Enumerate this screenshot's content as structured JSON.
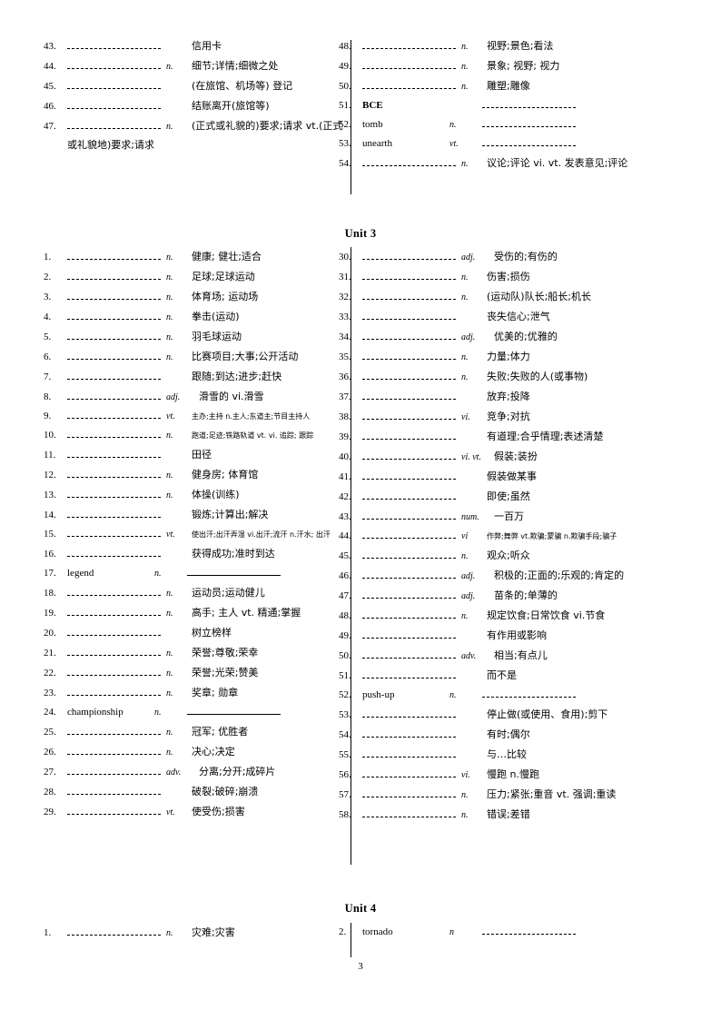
{
  "page": {
    "number": "3"
  },
  "units": [
    {
      "heading": "",
      "left_items": [
        {
          "num": "43.",
          "word": "",
          "pos": "",
          "meaning": "信用卡",
          "blank": "dash"
        },
        {
          "num": "44.",
          "word": "",
          "pos": "n.",
          "meaning": "细节;详情;细微之处",
          "blank": "dash"
        },
        {
          "num": "45.",
          "word": "",
          "pos": "",
          "meaning": "(在旅馆、机场等) 登记",
          "blank": "dash"
        },
        {
          "num": "46.",
          "word": "",
          "pos": "",
          "meaning": "结账离开(旅馆等)",
          "blank": "dash"
        },
        {
          "num": "47.",
          "word": "",
          "pos": "n.",
          "meaning": "(正式或礼貌的)要求;请求   vt.(正式",
          "blank": "dash",
          "continuation": "或礼貌地)要求;请求"
        }
      ],
      "right_items": [
        {
          "num": "48.",
          "word": "",
          "pos": "n.",
          "meaning": "视野;景色;看法",
          "blank": "dash"
        },
        {
          "num": "49.",
          "word": "",
          "pos": "n.",
          "meaning": "景象; 视野; 视力",
          "blank": "dash"
        },
        {
          "num": "50.",
          "word": "",
          "pos": "n.",
          "meaning": "雕塑;雕像",
          "blank": "dash"
        },
        {
          "num": "51.",
          "word": "BCE",
          "pos": "",
          "meaning": "",
          "blank": "answer-dash",
          "bold": true
        },
        {
          "num": "52.",
          "word": "tomb",
          "pos": "n.",
          "meaning": "",
          "blank": "answer-dash"
        },
        {
          "num": "53.",
          "word": "unearth",
          "pos": "vt.",
          "meaning": "",
          "blank": "answer-dash"
        },
        {
          "num": "54.",
          "word": "",
          "pos": "n.",
          "meaning": "议论;评论 vi. vt. 发表意见;评论",
          "blank": "dash"
        }
      ]
    },
    {
      "heading": "Unit 3",
      "left_items": [
        {
          "num": "1.",
          "word": "",
          "pos": "n.",
          "meaning": "健康; 健壮;适合",
          "blank": "dash"
        },
        {
          "num": "2.",
          "word": "",
          "pos": "n.",
          "meaning": "足球;足球运动",
          "blank": "dash"
        },
        {
          "num": "3.",
          "word": "",
          "pos": "n.",
          "meaning": "体育场; 运动场",
          "blank": "dash"
        },
        {
          "num": "4.",
          "word": "",
          "pos": "n.",
          "meaning": "拳击(运动)",
          "blank": "dash"
        },
        {
          "num": "5.",
          "word": "",
          "pos": "n.",
          "meaning": "羽毛球运动",
          "blank": "dash"
        },
        {
          "num": "6.",
          "word": "",
          "pos": "n.",
          "meaning": "比赛项目;大事;公开活动",
          "blank": "dash"
        },
        {
          "num": "7.",
          "word": "",
          "pos": "",
          "meaning": "跟随;到达;进步;赶快",
          "blank": "dash"
        },
        {
          "num": "8.",
          "word": "",
          "pos": "adj.",
          "meaning": "滑雪的 vi.滑雪",
          "blank": "dash"
        },
        {
          "num": "9.",
          "word": "",
          "pos": "vt.",
          "meaning": "主办;主持 n.主人;东道主;节目主持人",
          "blank": "dash",
          "small": true
        },
        {
          "num": "10.",
          "word": "",
          "pos": "n.",
          "meaning": "跑道;足迹;铁路轨道  vt. vi. 追踪; 跟踪",
          "blank": "dash",
          "small": true
        },
        {
          "num": "11.",
          "word": "",
          "pos": "",
          "meaning": "田径",
          "blank": "dash"
        },
        {
          "num": "12.",
          "word": "",
          "pos": "n.",
          "meaning": "健身房; 体育馆",
          "blank": "dash"
        },
        {
          "num": "13.",
          "word": "",
          "pos": "n.",
          "meaning": "体操(训练)",
          "blank": "dash"
        },
        {
          "num": "14.",
          "word": "",
          "pos": "",
          "meaning": "锻炼;计算出;解决",
          "blank": "dash"
        },
        {
          "num": "15.",
          "word": "",
          "pos": "vt.",
          "meaning": "使出汗;出汗弄湿  vi.出汗;流汗  n.汗水; 出汗",
          "blank": "dash",
          "small": true
        },
        {
          "num": "16.",
          "word": "",
          "pos": "",
          "meaning": "获得成功;准时到达",
          "blank": "dash"
        },
        {
          "num": "17.",
          "word": "legend",
          "pos": "n.",
          "meaning": "",
          "blank": "answer-solid"
        },
        {
          "num": "18.",
          "word": "",
          "pos": "n.",
          "meaning": "运动员;运动健儿",
          "blank": "dash"
        },
        {
          "num": "19.",
          "word": "",
          "pos": "n.",
          "meaning": "高手; 主人 vt. 精通;掌握",
          "blank": "dash"
        },
        {
          "num": "20.",
          "word": "",
          "pos": "",
          "meaning": "树立榜样",
          "blank": "dash"
        },
        {
          "num": "21.",
          "word": "",
          "pos": "n.",
          "meaning": "荣誉;尊敬;荣幸",
          "blank": "dash"
        },
        {
          "num": "22.",
          "word": "",
          "pos": "n.",
          "meaning": "荣誉;光荣;赞美",
          "blank": "dash"
        },
        {
          "num": "23.",
          "word": "",
          "pos": "n.",
          "meaning": "奖章; 勋章",
          "blank": "dash"
        },
        {
          "num": "24.",
          "word": "championship",
          "pos": "n.",
          "meaning": "",
          "blank": "answer-solid"
        },
        {
          "num": "25.",
          "word": "",
          "pos": "n.",
          "meaning": "冠军; 优胜者",
          "blank": "dash"
        },
        {
          "num": "26.",
          "word": "",
          "pos": "n.",
          "meaning": "决心;决定",
          "blank": "dash"
        },
        {
          "num": "27.",
          "word": "",
          "pos": "adv.",
          "meaning": "分离;分开;成碎片",
          "blank": "dash"
        },
        {
          "num": "28.",
          "word": "",
          "pos": "",
          "meaning": "破裂;破碎;崩溃",
          "blank": "dash"
        },
        {
          "num": "29.",
          "word": "",
          "pos": "vt.",
          "meaning": "使受伤;损害",
          "blank": "dash"
        }
      ],
      "right_items": [
        {
          "num": "30.",
          "word": "",
          "pos": "adj.",
          "meaning": "受伤的;有伤的",
          "blank": "dash"
        },
        {
          "num": "31.",
          "word": "",
          "pos": "n.",
          "meaning": "伤害;损伤",
          "blank": "dash"
        },
        {
          "num": "32.",
          "word": "",
          "pos": "n.",
          "meaning": "(运动队)队长;船长;机长",
          "blank": "dash"
        },
        {
          "num": "33.",
          "word": "",
          "pos": "",
          "meaning": "丧失信心;泄气",
          "blank": "dash"
        },
        {
          "num": "34.",
          "word": "",
          "pos": "adj.",
          "meaning": "优美的;优雅的",
          "blank": "dash"
        },
        {
          "num": "35.",
          "word": "",
          "pos": "n.",
          "meaning": "力量;体力",
          "blank": "dash"
        },
        {
          "num": "36.",
          "word": "",
          "pos": "n.",
          "meaning": "失败;失败的人(或事物)",
          "blank": "dash"
        },
        {
          "num": "37.",
          "word": "",
          "pos": "",
          "meaning": "放弃;投降",
          "blank": "dash"
        },
        {
          "num": "38.",
          "word": "",
          "pos": "vi.",
          "meaning": "竞争;对抗",
          "blank": "dash"
        },
        {
          "num": "39.",
          "word": "",
          "pos": "",
          "meaning": "有道理;合乎情理;表述清楚",
          "blank": "dash"
        },
        {
          "num": "40.",
          "word": "",
          "pos": "vi. vt.",
          "meaning": "假装;装扮",
          "blank": "dash"
        },
        {
          "num": "41.",
          "word": "",
          "pos": "",
          "meaning": "假装做某事",
          "blank": "dash"
        },
        {
          "num": "42.",
          "word": "",
          "pos": "",
          "meaning": "即使;虽然",
          "blank": "dash"
        },
        {
          "num": "43.",
          "word": "",
          "pos": "num.",
          "meaning": "一百万",
          "blank": "dash"
        },
        {
          "num": "44.",
          "word": "",
          "pos": "vi",
          "meaning": "作弊;舞弊 vt.欺骗;蒙骗  n.欺骗手段;骗子",
          "blank": "dash",
          "small": true
        },
        {
          "num": "45.",
          "word": "",
          "pos": "n.",
          "meaning": "观众;听众",
          "blank": "dash"
        },
        {
          "num": "46.",
          "word": "",
          "pos": "adj.",
          "meaning": "积极的;正面的;乐观的;肯定的",
          "blank": "dash"
        },
        {
          "num": "47.",
          "word": "",
          "pos": "adj.",
          "meaning": "苗条的;单薄的",
          "blank": "dash"
        },
        {
          "num": "48.",
          "word": "",
          "pos": "n.",
          "meaning": "规定饮食;日常饮食 vi.节食",
          "blank": "dash"
        },
        {
          "num": "49.",
          "word": "",
          "pos": "",
          "meaning": "有作用或影响",
          "blank": "dash"
        },
        {
          "num": "50.",
          "word": "",
          "pos": "adv.",
          "meaning": "相当;有点儿",
          "blank": "dash"
        },
        {
          "num": "51.",
          "word": "",
          "pos": "",
          "meaning": "而不是",
          "blank": "dash"
        },
        {
          "num": "52.",
          "word": "push-up",
          "pos": "n.",
          "meaning": "",
          "blank": "answer-dash"
        },
        {
          "num": "53.",
          "word": "",
          "pos": "",
          "meaning": "停止做(或使用、食用);剪下",
          "blank": "dash"
        },
        {
          "num": "54.",
          "word": "",
          "pos": "",
          "meaning": "有时;偶尔",
          "blank": "dash"
        },
        {
          "num": "55.",
          "word": "",
          "pos": "",
          "meaning": "与…比较",
          "blank": "dash"
        },
        {
          "num": "56.",
          "word": "",
          "pos": "vi.",
          "meaning": "慢跑 n.慢跑",
          "blank": "dash"
        },
        {
          "num": "57.",
          "word": "",
          "pos": "n.",
          "meaning": "压力;紧张;重音 vt. 强调;重读",
          "blank": "dash"
        },
        {
          "num": "58.",
          "word": "",
          "pos": "n.",
          "meaning": "错误;差错",
          "blank": "dash"
        }
      ]
    },
    {
      "heading": "Unit 4",
      "left_items": [
        {
          "num": "1.",
          "word": "",
          "pos": "n.",
          "meaning": "灾难;灾害",
          "blank": "dash"
        }
      ],
      "right_items": [
        {
          "num": "2.",
          "word": "tornado",
          "pos": "n",
          "meaning": "",
          "blank": "answer-dash"
        }
      ]
    }
  ]
}
